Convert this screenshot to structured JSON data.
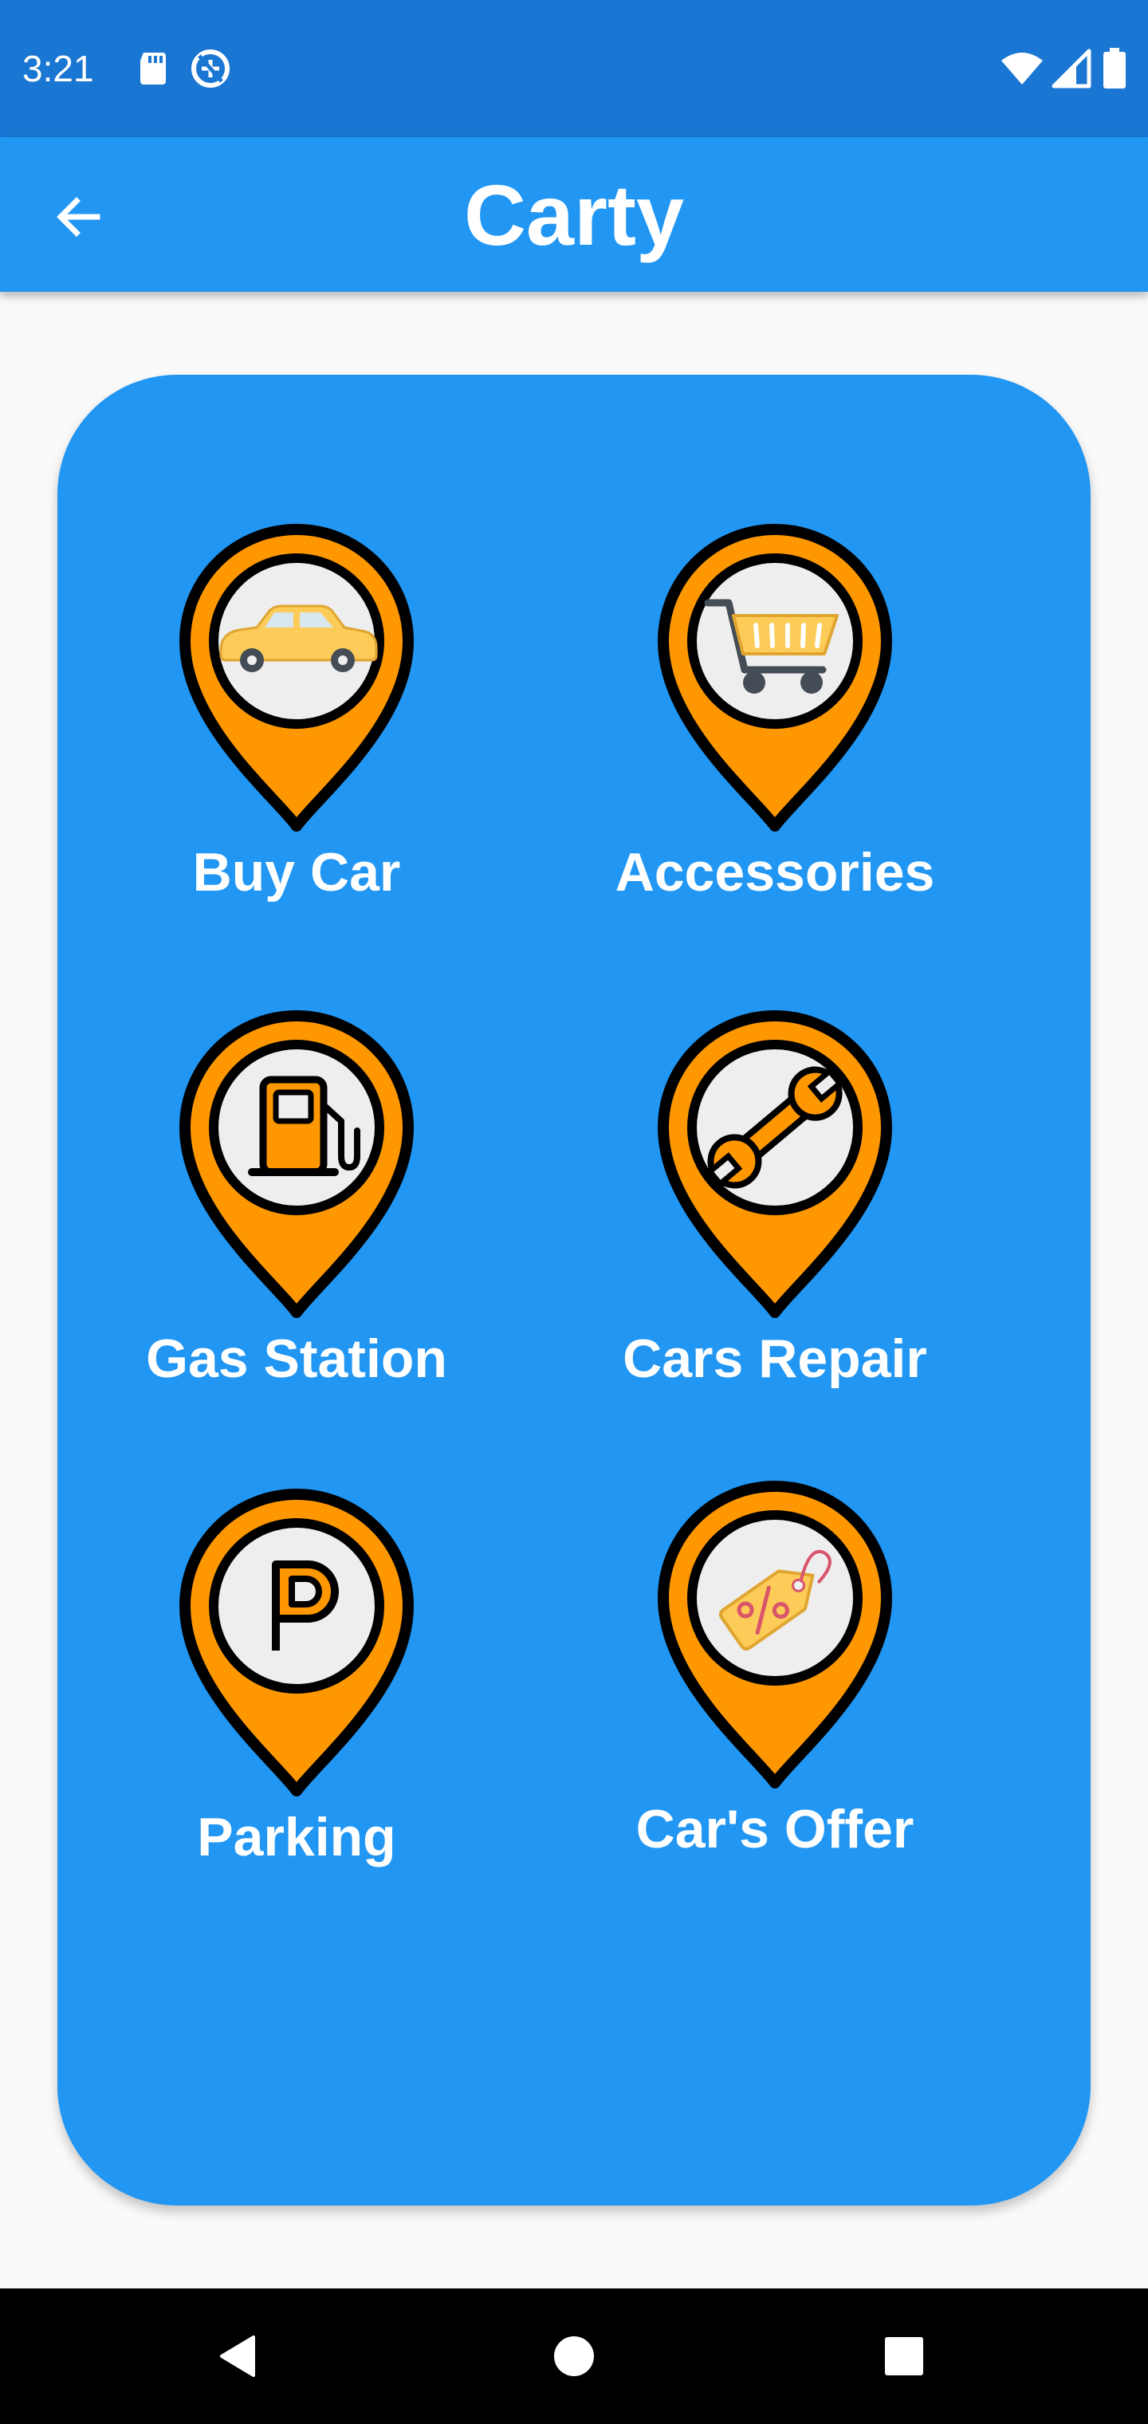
{
  "status_bar": {
    "time": "3:21",
    "icons": [
      "sd-card-icon",
      "data-saver-icon",
      "wifi-icon",
      "signal-icon",
      "battery-icon"
    ]
  },
  "app_bar": {
    "title": "Carty",
    "back_icon": "arrow-back-icon"
  },
  "colors": {
    "status_bar": "#1976D2",
    "app_bar": "#2196F3",
    "card": "#2196F3",
    "pin": "#FF9800",
    "pin_inner": "#EEEEEE",
    "background": "#FAFAFA"
  },
  "tiles": [
    {
      "label": "Buy Car",
      "icon": "car-icon"
    },
    {
      "label": "Accessories",
      "icon": "shopping-cart-icon"
    },
    {
      "label": "Gas Station",
      "icon": "fuel-pump-icon"
    },
    {
      "label": "Cars Repair",
      "icon": "wrench-icon"
    },
    {
      "label": "Parking",
      "icon": "parking-icon"
    },
    {
      "label": "Car's Offer",
      "icon": "discount-tag-icon"
    }
  ],
  "nav_bar": {
    "icons": [
      "back-triangle-icon",
      "home-circle-icon",
      "recents-square-icon"
    ]
  }
}
